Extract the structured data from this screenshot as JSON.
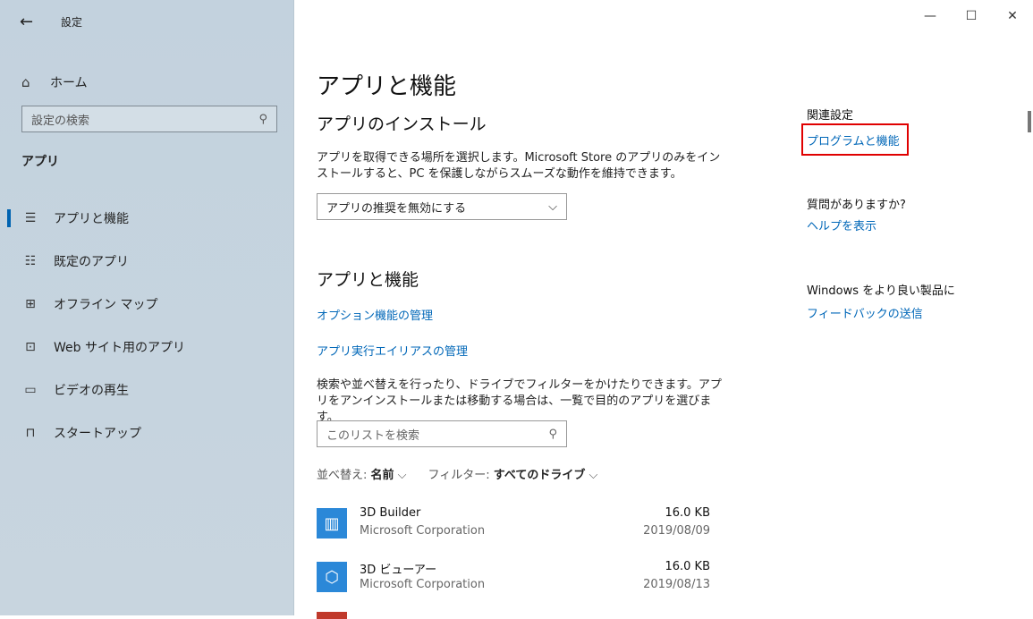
{
  "window": {
    "back_icon": "←",
    "title": "設定",
    "controls": [
      "—",
      "☐",
      "✕"
    ]
  },
  "sidebar": {
    "home_icon": "⌂",
    "home_label": "ホーム",
    "search_placeholder": "設定の検索",
    "section_label": "アプリ",
    "items": [
      {
        "icon": "☰",
        "label": "アプリと機能"
      },
      {
        "icon": "☷",
        "label": "既定のアプリ"
      },
      {
        "icon": "⊞",
        "label": "オフライン マップ"
      },
      {
        "icon": "⊡",
        "label": "Web サイト用のアプリ"
      },
      {
        "icon": "▭",
        "label": "ビデオの再生"
      },
      {
        "icon": "⊓",
        "label": "スタートアップ"
      }
    ]
  },
  "main": {
    "page_title": "アプリと機能",
    "install_heading": "アプリのインストール",
    "install_desc": "アプリを取得できる場所を選択します。Microsoft Store のアプリのみをインストールすると、PC を保護しながらスムーズな動作を維持できます。",
    "install_dropdown": "アプリの推奨を無効にする",
    "features_heading": "アプリと機能",
    "link_optional": "オプション機能の管理",
    "link_alias": "アプリ実行エイリアスの管理",
    "search_desc": "検索や並べ替えを行ったり、ドライブでフィルターをかけたりできます。アプリをアンインストールまたは移動する場合は、一覧で目的のアプリを選びます。",
    "list_search_placeholder": "このリストを検索",
    "sort_label": "並べ替え: ",
    "sort_value": "名前",
    "filter_label": "フィルター: ",
    "filter_value": "すべてのドライブ",
    "apps": [
      {
        "name": "3D Builder",
        "publisher": "Microsoft Corporation",
        "size": "16.0 KB",
        "date": "2019/08/09"
      },
      {
        "name": "3D ビューアー",
        "publisher": "Microsoft Corporation",
        "size": "16.0 KB",
        "date": "2019/08/13"
      }
    ]
  },
  "related": {
    "heading": "関連設定",
    "link_programs": "プログラムと機能",
    "help_heading": "質問がありますか?",
    "help_link": "ヘルプを表示",
    "feedback_heading": "Windows をより良い製品に",
    "feedback_link": "フィードバックの送信"
  }
}
